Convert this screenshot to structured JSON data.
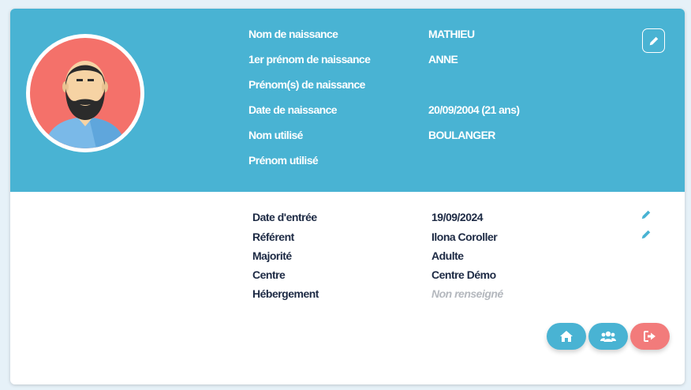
{
  "colors": {
    "header_bg": "#49b3d3",
    "avatar_bg": "#f4716a",
    "label_dark": "#1d2a44",
    "muted": "#b4b8be",
    "exit_button": "#f27b7b"
  },
  "profile": {
    "fields": [
      {
        "label": "Nom de naissance",
        "value": "MATHIEU"
      },
      {
        "label": "1er prénom de naissance",
        "value": "ANNE"
      },
      {
        "label": "Prénom(s) de naissance",
        "value": ""
      },
      {
        "label": "Date de naissance",
        "value": "20/09/2004 (21 ans)"
      },
      {
        "label": "Nom utilisé",
        "value": "BOULANGER"
      },
      {
        "label": "Prénom utilisé",
        "value": ""
      }
    ],
    "edit_icon": "pencil-icon"
  },
  "details": {
    "fields": [
      {
        "label": "Date d'entrée",
        "value": "19/09/2024",
        "editable": true
      },
      {
        "label": "Référent",
        "value": "Ilona Coroller",
        "editable": true
      },
      {
        "label": "Majorité",
        "value": "Adulte",
        "editable": false
      },
      {
        "label": "Centre",
        "value": "Centre Démo",
        "editable": false
      },
      {
        "label": "Hébergement",
        "value": "Non renseigné",
        "editable": false
      }
    ]
  },
  "actions": [
    {
      "icon": "home-icon",
      "color": "#49b3d3"
    },
    {
      "icon": "users-icon",
      "color": "#49b3d3"
    },
    {
      "icon": "sign-out-icon",
      "color": "#f27b7b"
    }
  ]
}
